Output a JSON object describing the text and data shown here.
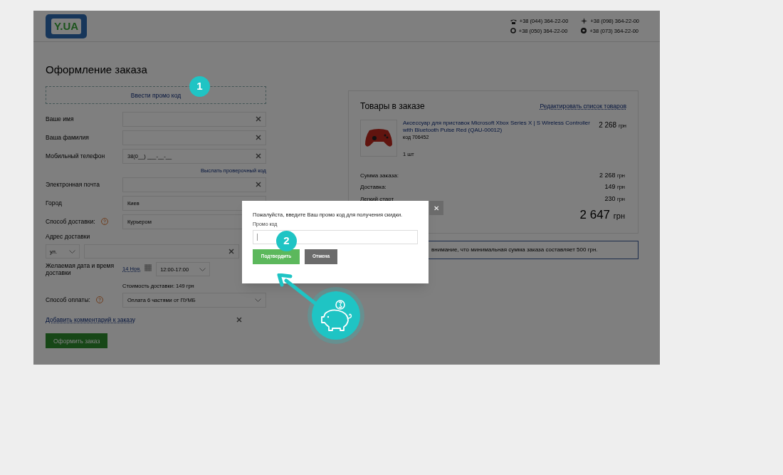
{
  "header": {
    "logo": "Y.UA",
    "phones": [
      {
        "kind": "landline",
        "number": "+38 (044) 364-22-00"
      },
      {
        "kind": "star",
        "number": "+38 (098) 364-22-00"
      },
      {
        "kind": "ring",
        "number": "+38 (050) 364-22-00"
      },
      {
        "kind": "swirl",
        "number": "+38 (073) 364-22-00"
      }
    ]
  },
  "title": "Оформление заказа",
  "promo_button": "Ввести промо код",
  "form": {
    "fields": [
      {
        "kind": "input",
        "label": "Ваше имя"
      },
      {
        "kind": "input",
        "label": "Ваша фамилия"
      },
      {
        "kind": "input",
        "label": "Мобильный телефон",
        "value": "38(0__) ___-__-__",
        "link": "Выслать проверочный код"
      },
      {
        "kind": "input",
        "label": "Электронная почта"
      },
      {
        "kind": "select",
        "label": "Город",
        "value": "Киев",
        "help": false
      },
      {
        "kind": "select",
        "label": "Способ доставки:",
        "value": "Курьером",
        "help": true
      }
    ],
    "address": {
      "label": "Адрес доставки",
      "street_type": "ул."
    },
    "delivery_time": {
      "label": "Желаемая дата и время доставки",
      "date": "14 Ноя.",
      "time": "12:00-17:00",
      "cost": "Стоимость доставки: 149 грн"
    },
    "payment": {
      "label": "Способ оплаты:",
      "value": "Оплата 6 частями от ПУМБ"
    },
    "comment_link": "Добавить комментарий к заказу",
    "submit": "Оформить заказ"
  },
  "order": {
    "title": "Товары в заказе",
    "edit_link": "Редактировать список товаров",
    "item": {
      "name": "Аксессуар для приставок Microsoft Xbox Series X | S Wireless Controller with Bluetooth Pulse Red (QAU-00012)",
      "code": "код 706452",
      "quantity": "1 шт",
      "price": "2 268",
      "currency": "грн"
    },
    "summary": [
      {
        "label": "Сумма заказа:",
        "value": "2 268",
        "currency": "грн"
      },
      {
        "label": "Доставка:",
        "value": "149",
        "currency": "грн"
      },
      {
        "label": "Легкий старт",
        "value": "230",
        "currency": "грн"
      }
    ],
    "total": {
      "value": "2 647",
      "currency": "грн"
    },
    "notice": "внимание, что минимальная сумма заказа составляет 500 грн."
  },
  "dialog": {
    "message": "Пожалуйста, введите Ваш промо код для получения скидки.",
    "field_label": "Промо код",
    "confirm": "Подтвердить",
    "cancel": "Отмена",
    "close": "✕"
  },
  "markers": [
    "1",
    "2"
  ]
}
